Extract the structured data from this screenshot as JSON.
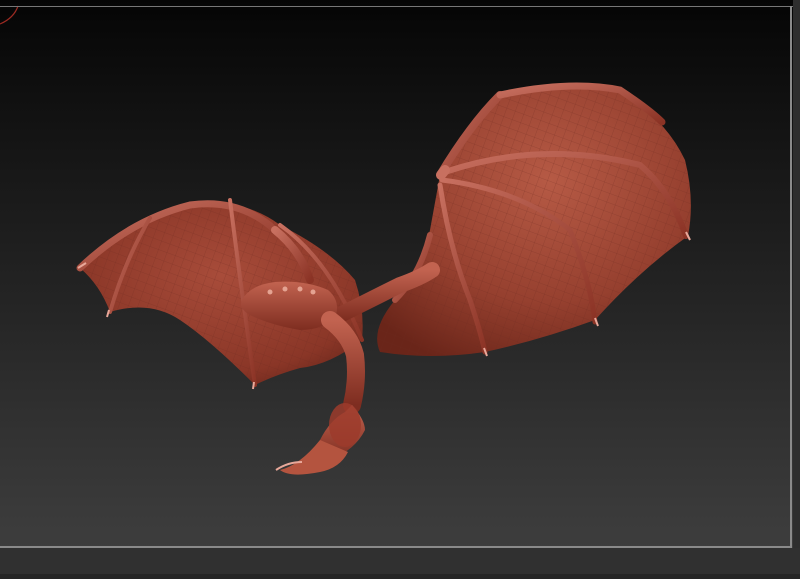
{
  "viewport": {
    "background_top": "#050505",
    "background_bottom": "#3f3f3f",
    "model_color": "#a0412f",
    "model_highlight": "#c46a55",
    "model_shadow": "#5a1c14"
  }
}
